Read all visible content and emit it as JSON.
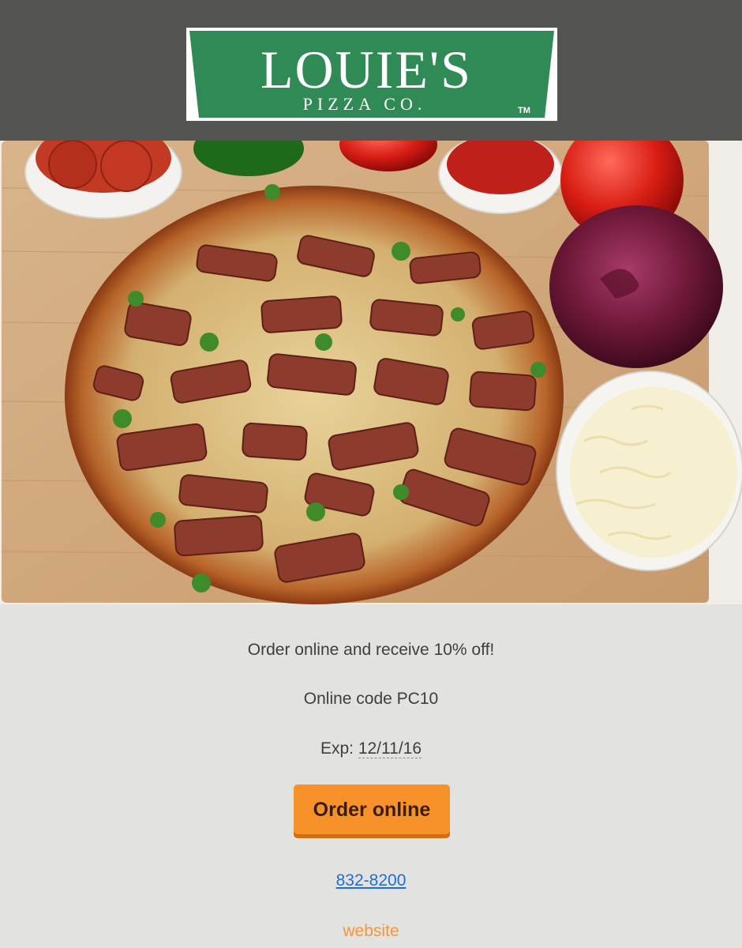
{
  "header": {
    "logo": {
      "brand": "LOUIE'S",
      "subtitle": "PIZZA CO.",
      "trademark": "TM",
      "color": "#2e8b57"
    }
  },
  "hero": {
    "image": "pizza-with-toppings-photo"
  },
  "content": {
    "promo_text": "Order online and receive 10% off!",
    "code_text": "Online code PC10",
    "exp_label": "Exp: ",
    "exp_date": "12/11/16",
    "order_button_label": "Order online",
    "phone": "832-8200",
    "website_link": "website"
  },
  "colors": {
    "header_bg": "#545552",
    "content_bg": "#e2e2e0",
    "button_bg": "#f7922a",
    "link_blue": "#1f6fd1",
    "link_orange": "#f0963c"
  }
}
